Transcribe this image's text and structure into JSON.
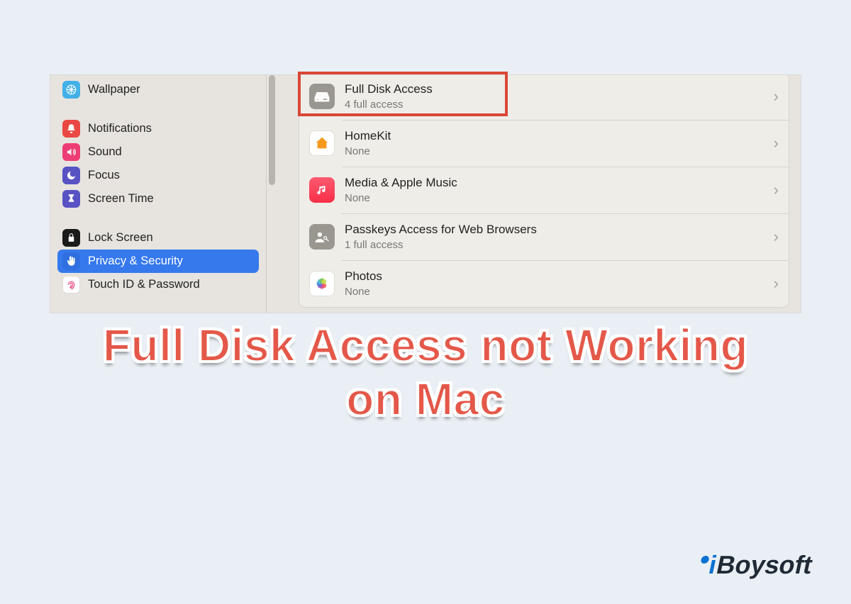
{
  "sidebar": {
    "items": [
      {
        "label": "Wallpaper"
      },
      {
        "label": "Notifications"
      },
      {
        "label": "Sound"
      },
      {
        "label": "Focus"
      },
      {
        "label": "Screen Time"
      },
      {
        "label": "Lock Screen"
      },
      {
        "label": "Privacy & Security"
      },
      {
        "label": "Touch ID & Password"
      }
    ]
  },
  "content": {
    "rows": [
      {
        "title": "Full Disk Access",
        "subtitle": "4 full access"
      },
      {
        "title": "HomeKit",
        "subtitle": "None"
      },
      {
        "title": "Media & Apple Music",
        "subtitle": "None"
      },
      {
        "title": "Passkeys Access for Web Browsers",
        "subtitle": "1 full access"
      },
      {
        "title": "Photos",
        "subtitle": "None"
      }
    ]
  },
  "headline": {
    "line1": "Full Disk Access not Working",
    "line2": "on Mac"
  },
  "brand": {
    "i": "i",
    "rest": "Boysoft"
  }
}
